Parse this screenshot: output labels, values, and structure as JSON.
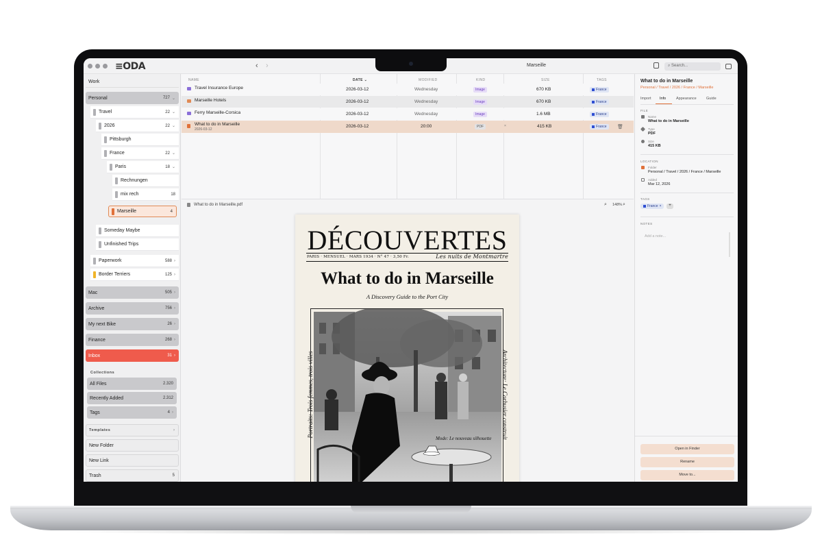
{
  "app": {
    "logo": "≡ODA",
    "window_title": "Marseille",
    "search_placeholder": "Search..."
  },
  "sidebar": {
    "work": "Work",
    "personal": {
      "label": "Personal",
      "count": "727"
    },
    "travel": {
      "label": "Travel",
      "count": "22"
    },
    "y2026": {
      "label": "2026",
      "count": "22"
    },
    "pittsburgh": {
      "label": "Pittsburgh"
    },
    "france": {
      "label": "France",
      "count": "22"
    },
    "paris": {
      "label": "Paris",
      "count": "18"
    },
    "rechnungen": {
      "label": "Rechnungen"
    },
    "mixrech": {
      "label": "mix rech",
      "count": "18"
    },
    "marseille": {
      "label": "Marseille",
      "count": "4"
    },
    "someday": {
      "label": "Someday Maybe"
    },
    "unfinished": {
      "label": "Unfinished Trips"
    },
    "paperwork": {
      "label": "Paperwork",
      "count": "588"
    },
    "border": {
      "label": "Border Terriers",
      "count": "125"
    },
    "mac": {
      "label": "Mac",
      "count": "505"
    },
    "archive": {
      "label": "Archive",
      "count": "756"
    },
    "bike": {
      "label": "My next Bike",
      "count": "26"
    },
    "finance": {
      "label": "Finance",
      "count": "268"
    },
    "inbox": {
      "label": "Inbox",
      "count": "31"
    },
    "collections_header": "Collections",
    "allfiles": {
      "label": "All Files",
      "count": "2.320"
    },
    "recent": {
      "label": "Recently Added",
      "count": "2.312"
    },
    "tags": {
      "label": "Tags",
      "count": "4"
    },
    "templates_header": "Templates",
    "newfolder": "New Folder",
    "newlink": "New Link",
    "trash": {
      "label": "Trash",
      "count": "5"
    }
  },
  "filelist": {
    "headers": {
      "name": "NAME",
      "date": "DATE",
      "modified": "MODIFIED",
      "kind": "KIND",
      "size": "SIZE",
      "tags": "TAGS"
    },
    "rows": [
      {
        "name": "Travel Insurance Europe",
        "date": "2026-03-12",
        "modified": "Wednesday",
        "kind": "Image",
        "size": "670 KB",
        "tag": "France"
      },
      {
        "name": "Marseille Hotels",
        "date": "2026-03-12",
        "modified": "Wednesday",
        "kind": "Image",
        "size": "670 KB",
        "tag": "France"
      },
      {
        "name": "Ferry Marseille-Corsica",
        "date": "2026-03-12",
        "modified": "Wednesday",
        "kind": "Image",
        "size": "1.6 MB",
        "tag": "France"
      },
      {
        "name": "What to do in Marseille",
        "subdate": "2026-03-12",
        "date": "2026-03-12",
        "modified": "20:00",
        "kind": "PDF",
        "size": "415 KB",
        "tag": "France"
      }
    ]
  },
  "preview": {
    "filename": "What to do in Marseille.pdf",
    "zoom": "148%",
    "doc": {
      "masthead": "DÉCOUVERTES",
      "meta_left": "PARIS · MENSUEL · MARS 1934 · N° 47 · 3,50 Fr.",
      "meta_right": "Les nuits de Montmartre",
      "headline": "What to do in Marseille",
      "subheadline": "A Discovery Guide to the Port City",
      "side_left": "Portraits: Trois femmes, trois villes",
      "side_right": "Architecture: Le Corbusier construit",
      "caption": "Mode: Le nouveau silhouette"
    }
  },
  "info": {
    "title": "What to do in Marseille",
    "path": "Personal / Travel / 2026 / France / Marseille",
    "tabs": [
      "Import",
      "Info",
      "Appearance",
      "Guide"
    ],
    "file_header": "FILE",
    "name_label": "Name",
    "name_value": "What to do in Marseille",
    "type_label": "Type",
    "type_value": "PDF",
    "size_label": "Size",
    "size_value": "415 KB",
    "location_header": "LOCATION",
    "folder_label": "Folder",
    "folder_value": "Personal / Travel / 2026 / France / Marseille",
    "added_label": "Added",
    "added_value": "Mar 12, 2026",
    "tags_header": "TAGS",
    "tag": "France",
    "notes_header": "NOTES",
    "notes_placeholder": "Add a note...",
    "open_finder": "Open in Finder",
    "rename": "Rename",
    "move_to": "Move to..."
  },
  "colors": {
    "accent": "#e0713a",
    "inbox": "#ef5b4c",
    "tag_blue": "#2f4fd3",
    "kind_image": "#6b3fc0"
  }
}
